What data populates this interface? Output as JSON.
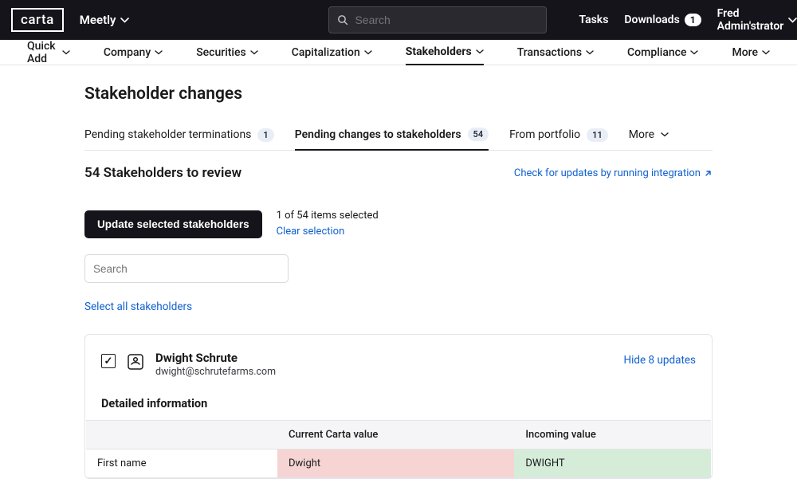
{
  "header": {
    "logo": "carta",
    "org": "Meetly",
    "search_placeholder": "Search",
    "tasks": "Tasks",
    "downloads": "Downloads",
    "downloads_count": "1",
    "user": "Fred Admin'strator"
  },
  "nav": {
    "quick_add": "Quick Add",
    "company": "Company",
    "securities": "Securities",
    "capitalization": "Capitalization",
    "stakeholders": "Stakeholders",
    "transactions": "Transactions",
    "compliance": "Compliance",
    "more": "More"
  },
  "page": {
    "title": "Stakeholder changes"
  },
  "tabs": {
    "pending_term": "Pending stakeholder terminations",
    "pending_term_count": "1",
    "pending_changes": "Pending changes to stakeholders",
    "pending_changes_count": "54",
    "from_portfolio": "From portfolio",
    "from_portfolio_count": "11",
    "more": "More"
  },
  "section": {
    "title": "54 Stakeholders to review",
    "check_updates": "Check for updates by running integration"
  },
  "actions": {
    "update_btn": "Update selected stakeholders",
    "selection_text": "1 of 54 items selected",
    "clear": "Clear selection",
    "search_placeholder": "Search",
    "select_all": "Select all stakeholders"
  },
  "stakeholder": {
    "name": "Dwight Schrute",
    "email": "dwight@schrutefarms.com",
    "hide_updates": "Hide 8 updates",
    "detail_title": "Detailed information",
    "col_current": "Current Carta value",
    "col_incoming": "Incoming value",
    "rows": [
      {
        "label": "First name",
        "current": "Dwight",
        "incoming": "DWIGHT"
      }
    ]
  }
}
